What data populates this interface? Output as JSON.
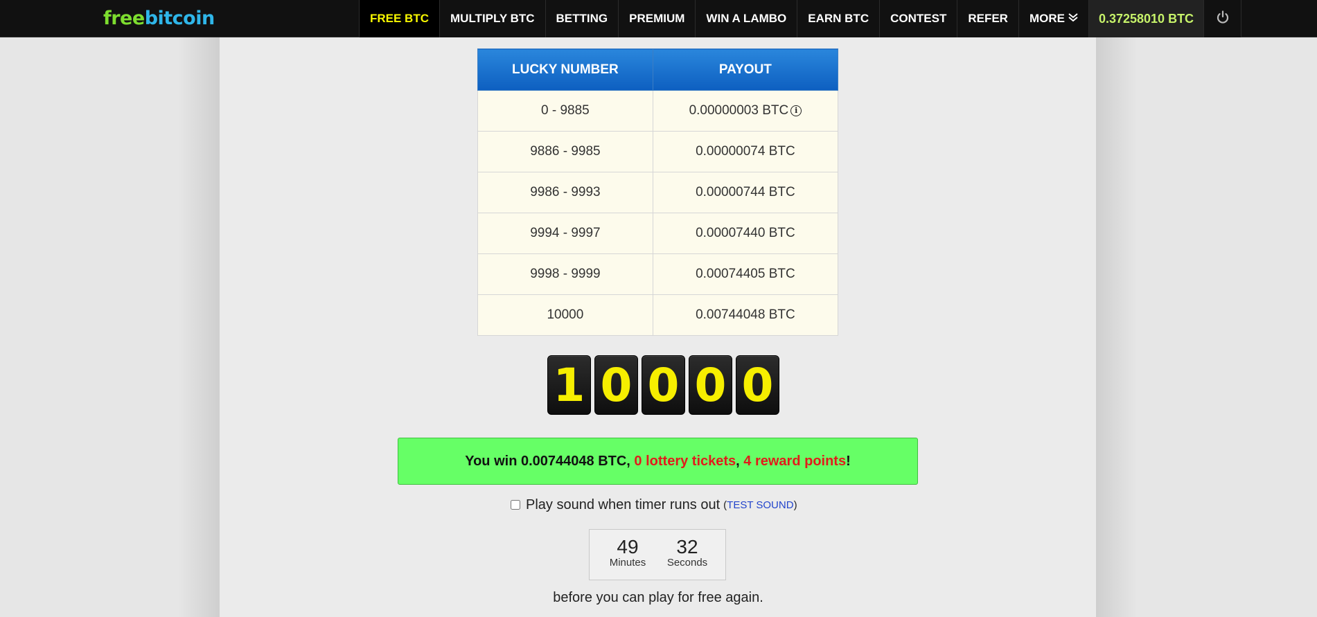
{
  "brand": {
    "part1": "free",
    "part2": "bitcoin"
  },
  "nav": {
    "items": [
      "FREE BTC",
      "MULTIPLY BTC",
      "BETTING",
      "PREMIUM",
      "WIN A LAMBO",
      "EARN BTC",
      "CONTEST",
      "REFER"
    ],
    "more_label": "MORE",
    "balance": "0.37258010 BTC",
    "active_item": "FREE BTC"
  },
  "payout_table": {
    "headers": [
      "LUCKY NUMBER",
      "PAYOUT"
    ],
    "rows": [
      [
        "0 - 9885",
        "0.00000003 BTC"
      ],
      [
        "9886 - 9985",
        "0.00000074 BTC"
      ],
      [
        "9986 - 9993",
        "0.00000744 BTC"
      ],
      [
        "9994 - 9997",
        "0.00007440 BTC"
      ],
      [
        "9998 - 9999",
        "0.00074405 BTC"
      ],
      [
        "10000",
        "0.00744048 BTC"
      ]
    ]
  },
  "lucky_number_digits": [
    "1",
    "0",
    "0",
    "0",
    "0"
  ],
  "win": {
    "prefix": "You win 0.00744048 BTC,",
    "tickets": "0 lottery tickets",
    "comma": ",",
    "points": "4 reward points",
    "suffix": "!"
  },
  "sound": {
    "label": "Play sound when timer runs out",
    "open_paren": "(",
    "link": "TEST SOUND",
    "close_paren": ")",
    "checked": false
  },
  "timer": {
    "minutes": "49",
    "minutes_label": "Minutes",
    "seconds": "32",
    "seconds_label": "Seconds"
  },
  "footer_text": "before you can play for free again.",
  "colors": {
    "accent_yellow": "#f7f700",
    "balance_green": "#c7f36a",
    "header_blue": "#1a72cf",
    "win_green": "#66ff66",
    "win_red": "#e21b1b"
  }
}
